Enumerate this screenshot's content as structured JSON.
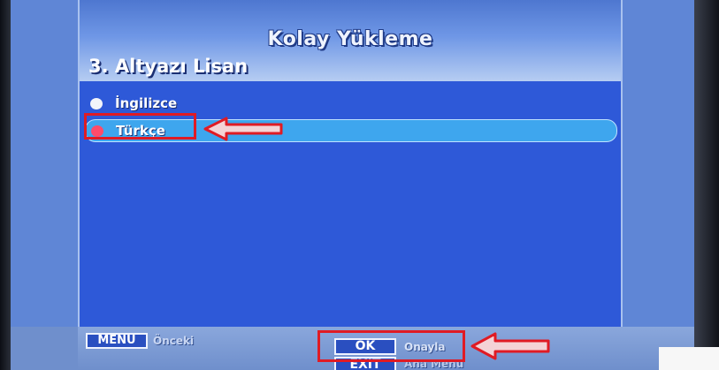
{
  "header": {
    "title": "Kolay Yükleme",
    "subtitle": "3. Altyazı Lisan"
  },
  "options": [
    {
      "label": "İngilizce",
      "selected": false
    },
    {
      "label": "Türkçe",
      "selected": true
    }
  ],
  "footer": {
    "menu_key": "MENU",
    "menu_caption": "Önceki",
    "ok_key": "OK",
    "ok_caption": "Onayla",
    "exit_key": "EXIT",
    "exit_caption": "Ana Menu"
  },
  "colors": {
    "content_bg": "#2e59d8",
    "selection_bar": "#3ea6ee",
    "active_dot": "#ff4b6b",
    "annotation_red": "#e01b24"
  },
  "annotations": {
    "arrow_icon": "left-arrow-icon"
  }
}
